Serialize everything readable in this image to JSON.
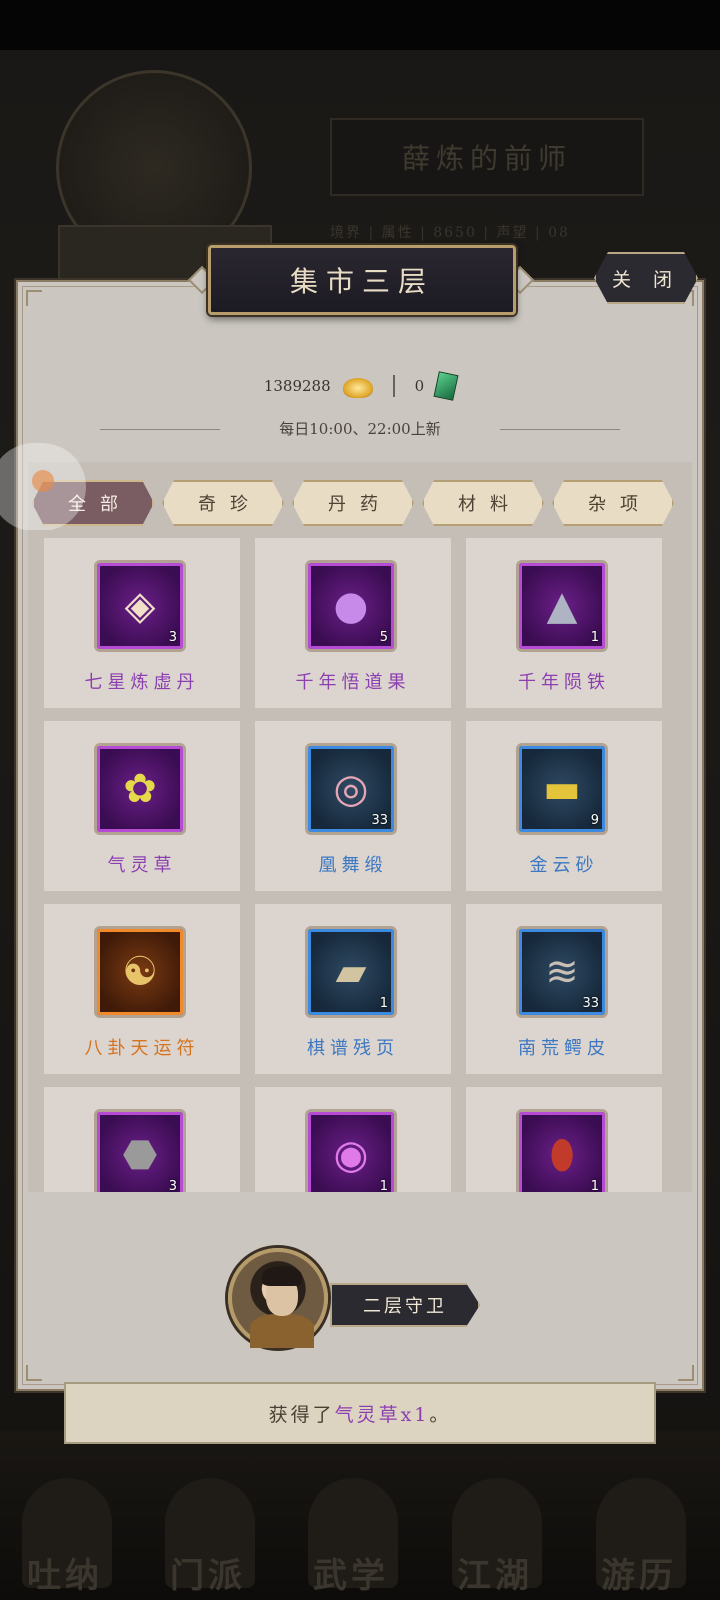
{
  "background": {
    "title": "薛炼的前师",
    "stats": "境界  |  属性  |  8650  |  声望  |  08",
    "nav": [
      "吐纳",
      "门派",
      "武学",
      "江湖",
      "游历"
    ]
  },
  "panel": {
    "title": "集市三层",
    "close_label": "关 闭"
  },
  "currency": {
    "gold_amount": "1389288",
    "jade_amount": "0",
    "gold_icon": "gold-ingot-icon",
    "jade_icon": "jade-token-icon"
  },
  "refresh_text": "每日10:00、22:00上新",
  "tabs": [
    {
      "label": "全部",
      "active": true
    },
    {
      "label": "奇珍",
      "active": false
    },
    {
      "label": "丹药",
      "active": false
    },
    {
      "label": "材料",
      "active": false
    },
    {
      "label": "杂项",
      "active": false
    }
  ],
  "items": [
    {
      "name": "七星炼虚丹",
      "count": "3",
      "rarity": "purple",
      "icon": "pill-paper-icon"
    },
    {
      "name": "千年悟道果",
      "count": "5",
      "rarity": "purple",
      "icon": "purple-fruit-icon"
    },
    {
      "name": "千年陨铁",
      "count": "1",
      "rarity": "purple",
      "icon": "meteorite-icon"
    },
    {
      "name": "气灵草",
      "count": "",
      "rarity": "purple",
      "icon": "herb-flower-icon"
    },
    {
      "name": "凰舞缎",
      "count": "33",
      "rarity": "blue",
      "icon": "silk-roll-icon"
    },
    {
      "name": "金云砂",
      "count": "9",
      "rarity": "blue",
      "icon": "gold-sand-icon"
    },
    {
      "name": "八卦天运符",
      "count": "",
      "rarity": "orange",
      "icon": "bagua-talisman-icon"
    },
    {
      "name": "棋谱残页",
      "count": "1",
      "rarity": "blue",
      "icon": "torn-page-icon"
    },
    {
      "name": "南荒鳄皮",
      "count": "33",
      "rarity": "blue",
      "icon": "crocodile-hide-icon"
    },
    {
      "name": "",
      "count": "3",
      "rarity": "purple",
      "icon": "ore-stone-icon"
    },
    {
      "name": "",
      "count": "1",
      "rarity": "purple",
      "icon": "orb-pedestal-icon"
    },
    {
      "name": "",
      "count": "1",
      "rarity": "purple",
      "icon": "wine-jar-icon"
    }
  ],
  "guard": {
    "label": "二层守卫",
    "icon": "guard-portrait-icon"
  },
  "toast": {
    "prefix": "获得了",
    "item": "气灵草x1",
    "suffix": "。"
  },
  "colors": {
    "purple": "#8c3fb0",
    "blue": "#3d78c2",
    "orange": "#d5731f",
    "panel": "#cbc6c0",
    "active_tab": "#7a5c63"
  }
}
